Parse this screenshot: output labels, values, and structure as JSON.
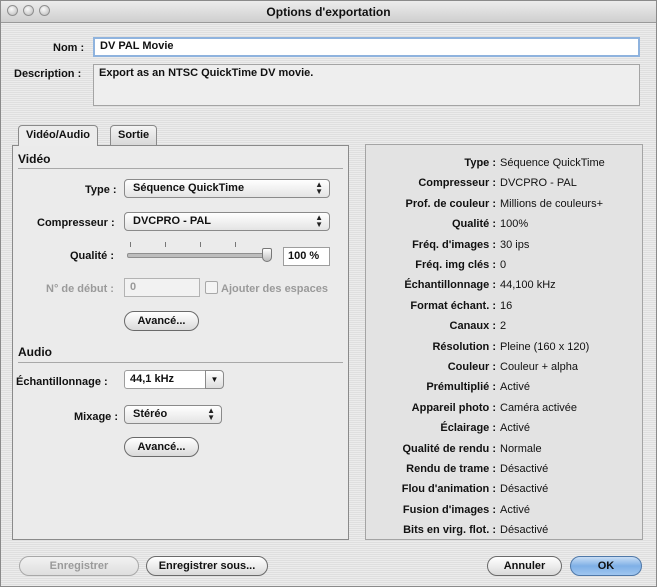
{
  "window": {
    "title": "Options d'exportation"
  },
  "form": {
    "name_label": "Nom :",
    "name_value": "DV PAL Movie",
    "description_label": "Description :",
    "description_value": "Export as an NTSC QuickTime DV movie."
  },
  "tabs": [
    {
      "label": "Vidéo/Audio",
      "active": true
    },
    {
      "label": "Sortie",
      "active": false
    }
  ],
  "video": {
    "section_title": "Vidéo",
    "type_label": "Type :",
    "type_value": "Séquence QuickTime",
    "compressor_label": "Compresseur :",
    "compressor_value": "DVCPRO - PAL",
    "quality_label": "Qualité :",
    "quality_value": "100 %",
    "quality_fraction": 1.0,
    "start_label": "N° de début :",
    "start_value": "0",
    "add_spaces_label": "Ajouter des espaces",
    "advanced_label": "Avancé..."
  },
  "audio": {
    "section_title": "Audio",
    "sampling_label": "Échantillonnage :",
    "sampling_value": "44,1 kHz",
    "mix_label": "Mixage :",
    "mix_value": "Stéréo",
    "advanced_label": "Avancé..."
  },
  "summary": [
    {
      "key": "Type :",
      "value": "Séquence QuickTime"
    },
    {
      "key": "Compresseur :",
      "value": "DVCPRO - PAL"
    },
    {
      "key": "Prof. de couleur :",
      "value": "Millions de couleurs+"
    },
    {
      "key": "Qualité :",
      "value": "100%"
    },
    {
      "key": "Fréq. d'images :",
      "value": "30 ips"
    },
    {
      "key": "Fréq. img clés :",
      "value": "0"
    },
    {
      "key": "Échantillonnage :",
      "value": "44,100 kHz"
    },
    {
      "key": "Format échant. :",
      "value": "16"
    },
    {
      "key": "Canaux :",
      "value": "2"
    },
    {
      "key": "Résolution :",
      "value": "Pleine (160 x 120)"
    },
    {
      "key": "Couleur :",
      "value": "Couleur + alpha"
    },
    {
      "key": "Prémultiplié :",
      "value": "Activé"
    },
    {
      "key": "Appareil photo :",
      "value": "Caméra activée"
    },
    {
      "key": "Éclairage :",
      "value": "Activé"
    },
    {
      "key": "Qualité de rendu :",
      "value": "Normale"
    },
    {
      "key": "Rendu de trame :",
      "value": "Désactivé"
    },
    {
      "key": "Flou d'animation :",
      "value": "Désactivé"
    },
    {
      "key": "Fusion d'images :",
      "value": "Activé"
    },
    {
      "key": "Bits en virg. flot. :",
      "value": "Désactivé"
    }
  ],
  "footer": {
    "save_label": "Enregistrer",
    "save_as_label": "Enregistrer sous...",
    "cancel_label": "Annuler",
    "ok_label": "OK"
  },
  "icons": {
    "popup_arrows": "updown-arrows-icon",
    "combo_arrow": "chevron-down-icon",
    "window_controls": "traffic-light-icon"
  }
}
